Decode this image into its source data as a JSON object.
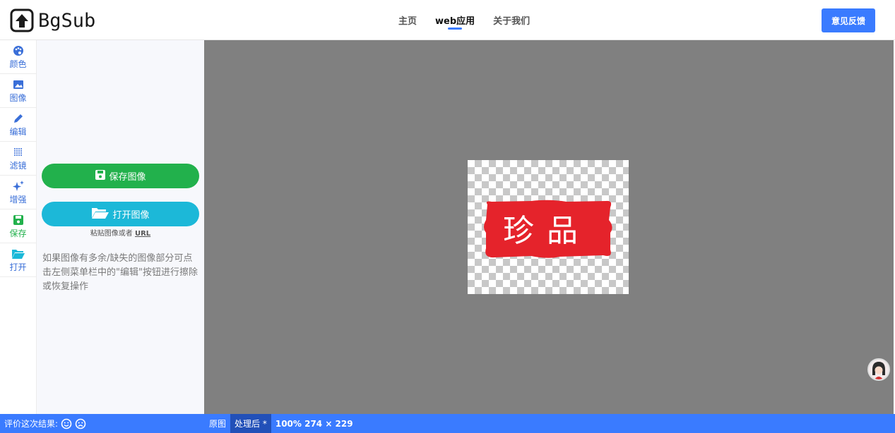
{
  "brand": {
    "name": "BgSub"
  },
  "nav": {
    "items": [
      {
        "label": "主页",
        "active": false
      },
      {
        "label": "web应用",
        "active": true
      },
      {
        "label": "关于我们",
        "active": false
      }
    ]
  },
  "header": {
    "feedback_label": "意见反馈"
  },
  "sidebar": {
    "items": [
      {
        "label": "颜色",
        "icon": "palette-icon"
      },
      {
        "label": "图像",
        "icon": "image-icon"
      },
      {
        "label": "编辑",
        "icon": "pencil-icon"
      },
      {
        "label": "滤镜",
        "icon": "dots-filter-icon"
      },
      {
        "label": "增强",
        "icon": "sparkle-icon"
      },
      {
        "label": "保存",
        "icon": "floppy-icon"
      },
      {
        "label": "打开",
        "icon": "folder-open-icon"
      }
    ]
  },
  "panel": {
    "save_label": "保存图像",
    "open_label": "打开图像",
    "paste_prefix": "粘贴图像或者 ",
    "paste_url": "URL",
    "hint": "如果图像有多余/缺失的图像部分可点击左侧菜单栏中的\"编辑\"按钮进行擦除或恢复操作"
  },
  "preview": {
    "seal_text": "珍品"
  },
  "statusbar": {
    "rate_label": "评价这次结果:",
    "tab_original": "原图",
    "tab_processed": "处理后 *",
    "zoom_info": "100% 274 × 229"
  },
  "colors": {
    "accent": "#3a7bff",
    "save_green": "#22b14c",
    "open_cyan": "#1cb8d8",
    "canvas_gray": "#808080",
    "seal_red": "#e5232b"
  }
}
